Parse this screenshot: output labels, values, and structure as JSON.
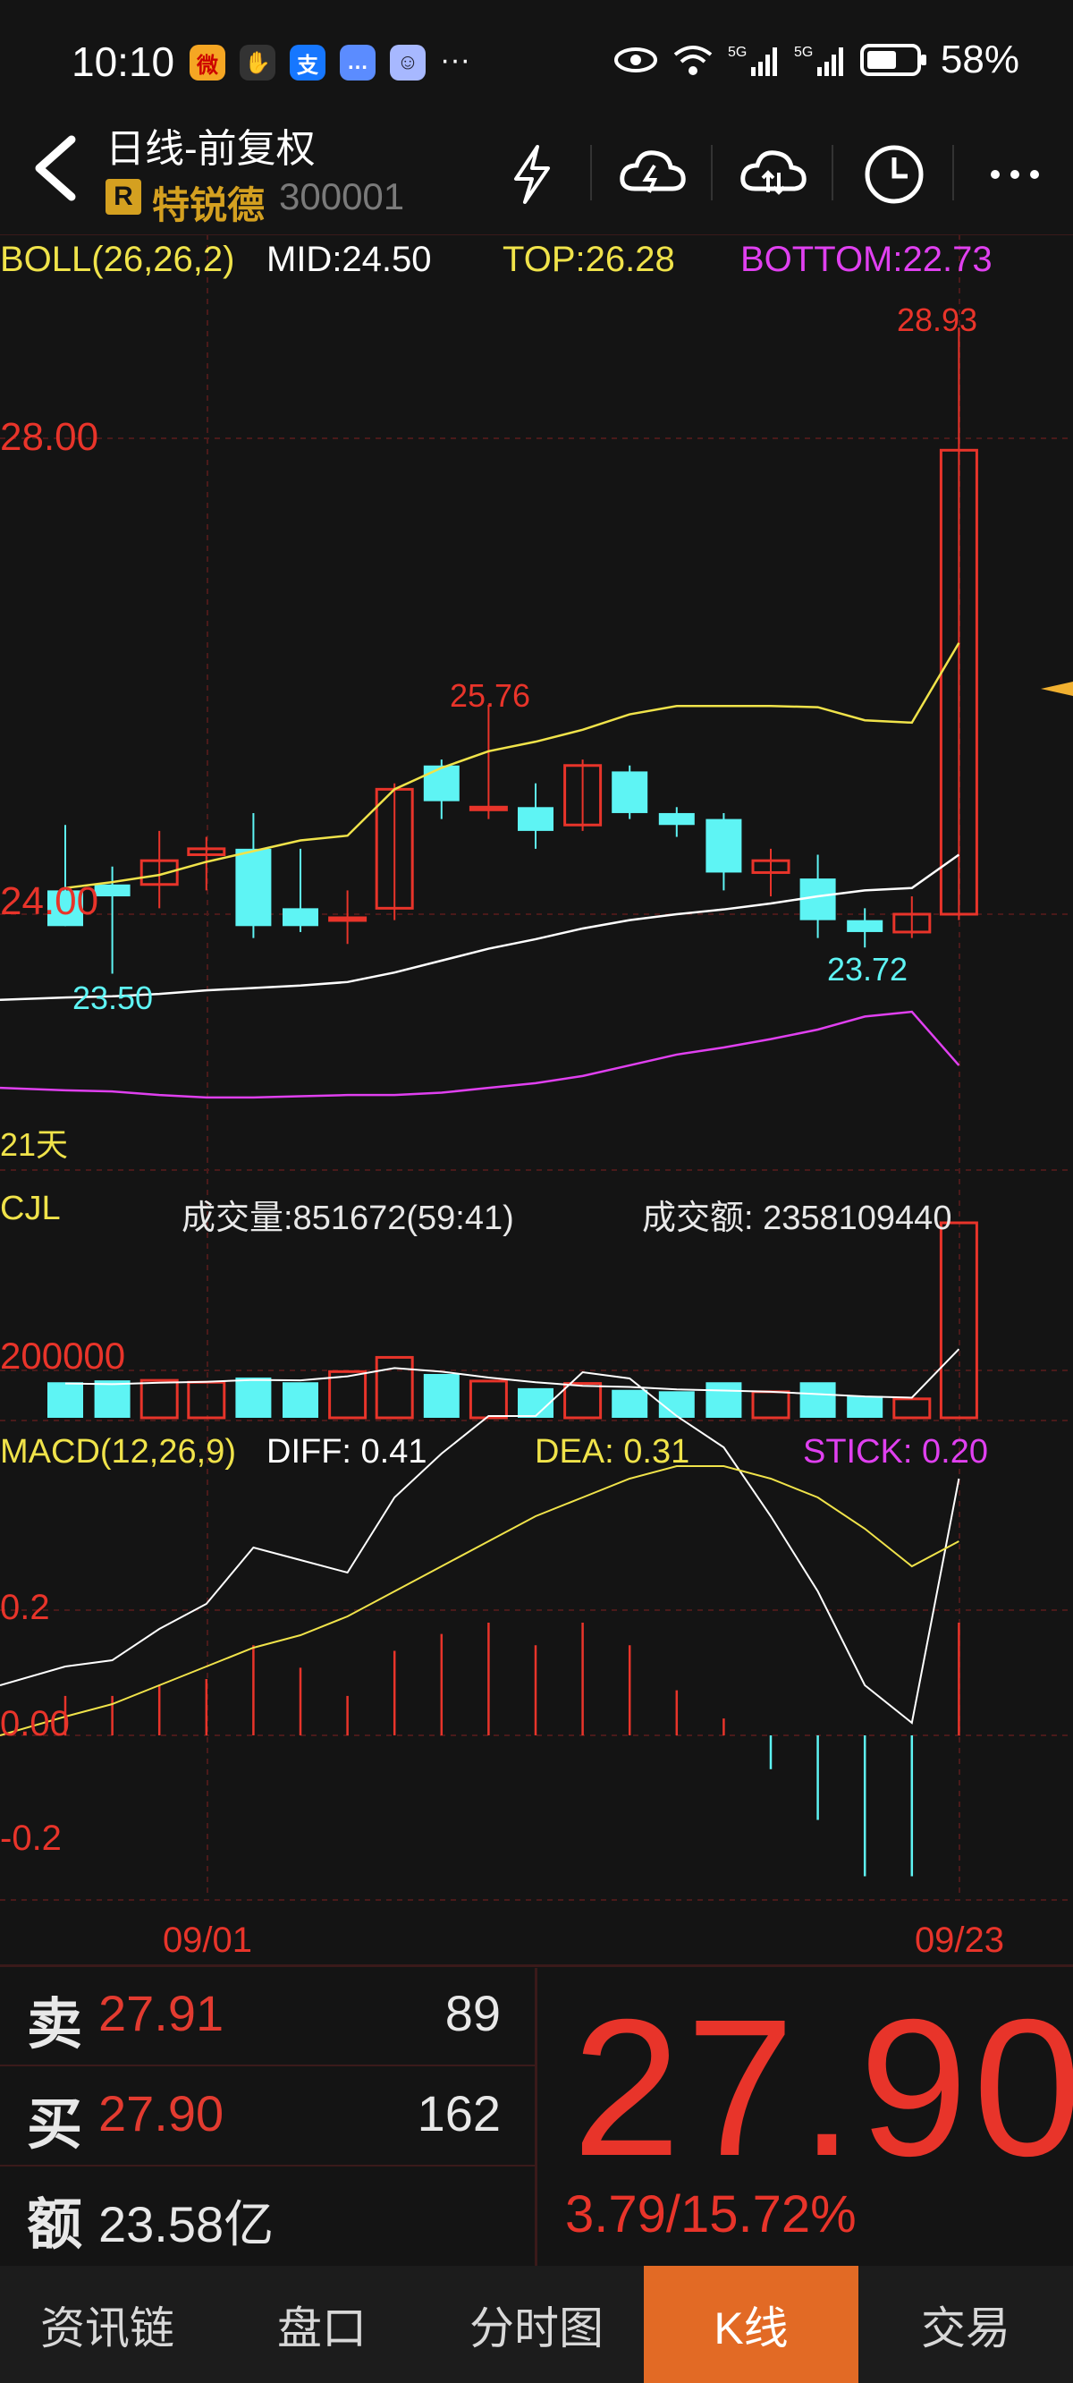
{
  "status_bar": {
    "time": "10:10",
    "apps": [
      {
        "icon": "weibo-icon",
        "label": "微",
        "color": "#f5a623"
      },
      {
        "icon": "hand-icon",
        "label": "✋",
        "color": "#333333"
      },
      {
        "icon": "alipay-icon",
        "label": "支",
        "color": "#1677ff"
      },
      {
        "icon": "message-icon",
        "label": "…",
        "color": "#5b8cff"
      },
      {
        "icon": "assistant-icon",
        "label": "☺",
        "color": "#a7b8ff"
      }
    ],
    "more": "···",
    "battery": "58%"
  },
  "header": {
    "title": "日线-前复权",
    "badge": "R",
    "stock_name": "特锐德",
    "stock_code": "300001",
    "buttons": [
      "flash-icon",
      "cloud-upload-icon",
      "cloud-sync-icon",
      "clock-icon",
      "more-icon"
    ]
  },
  "indicators": {
    "boll": {
      "name": "BOLL(26,26,2)",
      "mid": "MID:24.50",
      "top": "TOP:26.28",
      "bottom": "BOTTOM:22.73"
    },
    "cjl": {
      "name": "CJL",
      "volume": "成交量:851672(59:41)",
      "amount": "成交额: 2358109440"
    },
    "macd": {
      "name": "MACD(12,26,9)",
      "diff": "DIFF: 0.41",
      "dea": "DEA: 0.31",
      "stick": "STICK: 0.20"
    }
  },
  "chart_labels": {
    "price_axis_28": "28.00",
    "price_axis_24": "24.00",
    "high_label": "28.93",
    "peak_label": "25.76",
    "low_label_1": "23.50",
    "low_label_2": "23.72",
    "period": "21天",
    "volume_axis": "200000",
    "macd_axis_02": "0.2",
    "macd_axis_00": "0.00",
    "macd_axis_n02": "-0.2",
    "date_start": "09/01",
    "date_end": "09/23"
  },
  "chart_data": {
    "type": "candlestick",
    "candles": [
      {
        "o": 24.2,
        "h": 24.75,
        "l": 23.9,
        "c": 23.9,
        "dir": "down"
      },
      {
        "o": 24.25,
        "h": 24.4,
        "l": 23.5,
        "c": 24.15,
        "dir": "down"
      },
      {
        "o": 24.25,
        "h": 24.7,
        "l": 24.05,
        "c": 24.45,
        "dir": "up"
      },
      {
        "o": 24.5,
        "h": 24.65,
        "l": 24.2,
        "c": 24.55,
        "dir": "up"
      },
      {
        "o": 24.55,
        "h": 24.85,
        "l": 23.8,
        "c": 23.9,
        "dir": "down"
      },
      {
        "o": 24.05,
        "h": 24.55,
        "l": 23.85,
        "c": 23.9,
        "dir": "down"
      },
      {
        "o": 23.95,
        "h": 24.2,
        "l": 23.75,
        "c": 23.97,
        "dir": "up"
      },
      {
        "o": 24.05,
        "h": 25.1,
        "l": 23.95,
        "c": 25.05,
        "dir": "up"
      },
      {
        "o": 25.25,
        "h": 25.3,
        "l": 24.8,
        "c": 24.95,
        "dir": "down"
      },
      {
        "o": 24.9,
        "h": 25.76,
        "l": 24.8,
        "c": 24.9,
        "dir": "up"
      },
      {
        "o": 24.9,
        "h": 25.1,
        "l": 24.55,
        "c": 24.7,
        "dir": "down"
      },
      {
        "o": 24.75,
        "h": 25.3,
        "l": 24.7,
        "c": 25.25,
        "dir": "up"
      },
      {
        "o": 25.2,
        "h": 25.25,
        "l": 24.8,
        "c": 24.85,
        "dir": "down"
      },
      {
        "o": 24.85,
        "h": 24.9,
        "l": 24.65,
        "c": 24.75,
        "dir": "down"
      },
      {
        "o": 24.8,
        "h": 24.85,
        "l": 24.2,
        "c": 24.35,
        "dir": "down"
      },
      {
        "o": 24.35,
        "h": 24.55,
        "l": 24.15,
        "c": 24.45,
        "dir": "up"
      },
      {
        "o": 24.3,
        "h": 24.5,
        "l": 23.8,
        "c": 23.95,
        "dir": "down"
      },
      {
        "o": 23.95,
        "h": 24.05,
        "l": 23.72,
        "c": 23.85,
        "dir": "down"
      },
      {
        "o": 23.85,
        "h": 24.15,
        "l": 23.8,
        "c": 24.0,
        "dir": "up"
      },
      {
        "o": 24.0,
        "h": 28.93,
        "l": 23.95,
        "c": 27.9,
        "dir": "up"
      }
    ],
    "boll_upper": [
      24.22,
      24.27,
      24.33,
      24.44,
      24.53,
      24.62,
      24.66,
      25.05,
      25.23,
      25.37,
      25.45,
      25.55,
      25.68,
      25.75,
      25.75,
      25.75,
      25.74,
      25.63,
      25.61,
      26.28
    ],
    "boll_mid": [
      23.3,
      23.31,
      23.33,
      23.36,
      23.38,
      23.4,
      23.43,
      23.51,
      23.61,
      23.71,
      23.79,
      23.88,
      23.95,
      24.0,
      24.04,
      24.09,
      24.15,
      24.2,
      24.22,
      24.5
    ],
    "boll_lower": [
      22.52,
      22.51,
      22.48,
      22.46,
      22.46,
      22.47,
      22.48,
      22.48,
      22.5,
      22.54,
      22.58,
      22.64,
      22.73,
      22.82,
      22.88,
      22.95,
      23.03,
      23.14,
      23.18,
      22.73
    ],
    "volume": [
      {
        "v": 150000,
        "dir": "down"
      },
      {
        "v": 158000,
        "dir": "down"
      },
      {
        "v": 158000,
        "dir": "up"
      },
      {
        "v": 150000,
        "dir": "up"
      },
      {
        "v": 170000,
        "dir": "down"
      },
      {
        "v": 150000,
        "dir": "down"
      },
      {
        "v": 195000,
        "dir": "up"
      },
      {
        "v": 255000,
        "dir": "up"
      },
      {
        "v": 185000,
        "dir": "down"
      },
      {
        "v": 155000,
        "dir": "up"
      },
      {
        "v": 125000,
        "dir": "down"
      },
      {
        "v": 145000,
        "dir": "up"
      },
      {
        "v": 118000,
        "dir": "down"
      },
      {
        "v": 112000,
        "dir": "down"
      },
      {
        "v": 150000,
        "dir": "down"
      },
      {
        "v": 110000,
        "dir": "up"
      },
      {
        "v": 150000,
        "dir": "down"
      },
      {
        "v": 92000,
        "dir": "down"
      },
      {
        "v": 80000,
        "dir": "up"
      },
      {
        "v": 851672,
        "dir": "up"
      }
    ],
    "vol_ma": [
      145000,
      142000,
      148000,
      152000,
      160000,
      158000,
      175000,
      210000,
      195000,
      170000,
      150000,
      135000,
      130000,
      120000,
      115000,
      110000,
      100000,
      90000,
      85000,
      290000
    ],
    "macd_diff": [
      0.11,
      0.12,
      0.17,
      0.21,
      0.3,
      0.28,
      0.26,
      0.38,
      0.45,
      0.51,
      0.51,
      0.58,
      0.57,
      0.51,
      0.46,
      0.35,
      0.23,
      0.08,
      0.02,
      0.41
    ],
    "macd_dea": [
      0.03,
      0.05,
      0.08,
      0.11,
      0.14,
      0.16,
      0.19,
      0.23,
      0.27,
      0.31,
      0.35,
      0.38,
      0.41,
      0.43,
      0.43,
      0.41,
      0.38,
      0.33,
      0.27,
      0.31
    ],
    "macd_stick": [
      0.07,
      0.07,
      0.09,
      0.1,
      0.16,
      0.12,
      0.07,
      0.15,
      0.18,
      0.2,
      0.16,
      0.2,
      0.16,
      0.08,
      0.03,
      -0.06,
      -0.15,
      -0.25,
      -0.25,
      0.2
    ]
  },
  "quote": {
    "sell_label": "卖",
    "sell_price": "27.91",
    "sell_volume": "89",
    "buy_label": "买",
    "buy_price": "27.90",
    "buy_volume": "162",
    "amount_label": "额",
    "amount_value": "23.58亿",
    "last_price": "27.90",
    "change": "3.79/15.72%"
  },
  "tabs": [
    {
      "label": "资讯链",
      "active": false
    },
    {
      "label": "盘口",
      "active": false
    },
    {
      "label": "分时图",
      "active": false
    },
    {
      "label": "K线",
      "active": true
    },
    {
      "label": "交易",
      "active": false
    }
  ],
  "colors": {
    "up": "#e8342a",
    "down": "#5ef4f4",
    "boll_upper": "#f0e34a",
    "boll_mid": "#ffffff",
    "boll_lower": "#e040f0",
    "accent_tab": "#e26a25"
  }
}
